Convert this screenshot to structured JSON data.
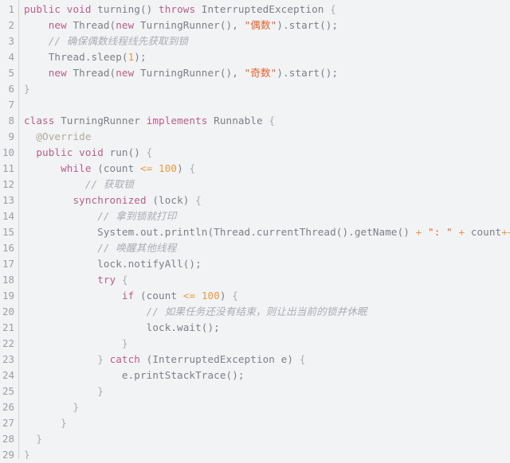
{
  "editor": {
    "language": "java",
    "background_color": "#f2f3f5",
    "gutter_color": "#f2f3f5",
    "line_number_color": "#9a9ea6",
    "total_lines": 29,
    "theme_colors": {
      "keyword": "#b75f8c",
      "string": "#e8622a",
      "number": "#e89a3c",
      "operator": "#e89a3c",
      "comment": "#a8acb4",
      "annotation": "#b0aa9a",
      "plain": "#7b7f88",
      "punctuation": "#a9adb5"
    }
  },
  "line_numbers": [
    "1",
    "2",
    "3",
    "4",
    "5",
    "6",
    "7",
    "8",
    "9",
    "10",
    "11",
    "12",
    "13",
    "14",
    "15",
    "16",
    "17",
    "18",
    "19",
    "20",
    "21",
    "22",
    "23",
    "24",
    "25",
    "26",
    "27",
    "28",
    "29"
  ],
  "code_lines": [
    {
      "n": 1,
      "tokens": [
        {
          "t": "public",
          "c": "kw"
        },
        {
          "t": " ",
          "c": "plain"
        },
        {
          "t": "void",
          "c": "kw"
        },
        {
          "t": " turning() ",
          "c": "plain"
        },
        {
          "t": "throws",
          "c": "kw"
        },
        {
          "t": " InterruptedException ",
          "c": "plain"
        },
        {
          "t": "{",
          "c": "punct"
        }
      ]
    },
    {
      "n": 2,
      "tokens": [
        {
          "t": "    ",
          "c": "plain"
        },
        {
          "t": "new",
          "c": "kw"
        },
        {
          "t": " Thread(",
          "c": "plain"
        },
        {
          "t": "new",
          "c": "kw"
        },
        {
          "t": " TurningRunner(), ",
          "c": "plain"
        },
        {
          "t": "\"偶数\"",
          "c": "str"
        },
        {
          "t": ").start();",
          "c": "plain"
        }
      ]
    },
    {
      "n": 3,
      "tokens": [
        {
          "t": "    ",
          "c": "plain"
        },
        {
          "t": "// 确保偶数线程线先获取到锁",
          "c": "comment"
        }
      ]
    },
    {
      "n": 4,
      "tokens": [
        {
          "t": "    Thread.sleep(",
          "c": "plain"
        },
        {
          "t": "1",
          "c": "num"
        },
        {
          "t": ");",
          "c": "plain"
        }
      ]
    },
    {
      "n": 5,
      "tokens": [
        {
          "t": "    ",
          "c": "plain"
        },
        {
          "t": "new",
          "c": "kw"
        },
        {
          "t": " Thread(",
          "c": "plain"
        },
        {
          "t": "new",
          "c": "kw"
        },
        {
          "t": " TurningRunner(), ",
          "c": "plain"
        },
        {
          "t": "\"奇数\"",
          "c": "str"
        },
        {
          "t": ").start();",
          "c": "plain"
        }
      ]
    },
    {
      "n": 6,
      "tokens": [
        {
          "t": "}",
          "c": "punct"
        }
      ]
    },
    {
      "n": 7,
      "tokens": []
    },
    {
      "n": 8,
      "tokens": [
        {
          "t": "class",
          "c": "kw"
        },
        {
          "t": " TurningRunner ",
          "c": "plain"
        },
        {
          "t": "implements",
          "c": "kw"
        },
        {
          "t": " Runnable ",
          "c": "plain"
        },
        {
          "t": "{",
          "c": "punct"
        }
      ]
    },
    {
      "n": 9,
      "tokens": [
        {
          "t": "  ",
          "c": "plain"
        },
        {
          "t": "@Override",
          "c": "anno"
        }
      ]
    },
    {
      "n": 10,
      "tokens": [
        {
          "t": "  ",
          "c": "plain"
        },
        {
          "t": "public",
          "c": "kw"
        },
        {
          "t": " ",
          "c": "plain"
        },
        {
          "t": "void",
          "c": "kw"
        },
        {
          "t": " run() ",
          "c": "plain"
        },
        {
          "t": "{",
          "c": "punct"
        }
      ]
    },
    {
      "n": 11,
      "tokens": [
        {
          "t": "      ",
          "c": "plain"
        },
        {
          "t": "while",
          "c": "kw"
        },
        {
          "t": " (count ",
          "c": "plain"
        },
        {
          "t": "<=",
          "c": "op"
        },
        {
          "t": " ",
          "c": "plain"
        },
        {
          "t": "100",
          "c": "num"
        },
        {
          "t": ") ",
          "c": "plain"
        },
        {
          "t": "{",
          "c": "punct"
        }
      ]
    },
    {
      "n": 12,
      "tokens": [
        {
          "t": "          ",
          "c": "plain"
        },
        {
          "t": "// 获取锁",
          "c": "comment"
        }
      ]
    },
    {
      "n": 13,
      "tokens": [
        {
          "t": "        ",
          "c": "plain"
        },
        {
          "t": "synchronized",
          "c": "kw"
        },
        {
          "t": " (lock) ",
          "c": "plain"
        },
        {
          "t": "{",
          "c": "punct"
        }
      ]
    },
    {
      "n": 14,
      "tokens": [
        {
          "t": "            ",
          "c": "plain"
        },
        {
          "t": "// 拿到锁就打印",
          "c": "comment"
        }
      ]
    },
    {
      "n": 15,
      "tokens": [
        {
          "t": "            System.out.println(Thread.currentThread().getName() ",
          "c": "plain"
        },
        {
          "t": "+",
          "c": "op"
        },
        {
          "t": " ",
          "c": "plain"
        },
        {
          "t": "\": \"",
          "c": "str"
        },
        {
          "t": " ",
          "c": "plain"
        },
        {
          "t": "+",
          "c": "op"
        },
        {
          "t": " count",
          "c": "plain"
        },
        {
          "t": "++",
          "c": "op"
        },
        {
          "t": ");",
          "c": "plain"
        }
      ]
    },
    {
      "n": 16,
      "tokens": [
        {
          "t": "            ",
          "c": "plain"
        },
        {
          "t": "// 唤醒其他线程",
          "c": "comment"
        }
      ]
    },
    {
      "n": 17,
      "tokens": [
        {
          "t": "            lock.notifyAll();",
          "c": "plain"
        }
      ]
    },
    {
      "n": 18,
      "tokens": [
        {
          "t": "            ",
          "c": "plain"
        },
        {
          "t": "try",
          "c": "kw"
        },
        {
          "t": " ",
          "c": "plain"
        },
        {
          "t": "{",
          "c": "punct"
        }
      ]
    },
    {
      "n": 19,
      "tokens": [
        {
          "t": "                ",
          "c": "plain"
        },
        {
          "t": "if",
          "c": "kw"
        },
        {
          "t": " (count ",
          "c": "plain"
        },
        {
          "t": "<=",
          "c": "op"
        },
        {
          "t": " ",
          "c": "plain"
        },
        {
          "t": "100",
          "c": "num"
        },
        {
          "t": ") ",
          "c": "plain"
        },
        {
          "t": "{",
          "c": "punct"
        }
      ]
    },
    {
      "n": 20,
      "tokens": [
        {
          "t": "                    ",
          "c": "plain"
        },
        {
          "t": "// 如果任务还没有结束，则让出当前的锁并休眠",
          "c": "comment"
        }
      ]
    },
    {
      "n": 21,
      "tokens": [
        {
          "t": "                    lock.wait();",
          "c": "plain"
        }
      ]
    },
    {
      "n": 22,
      "tokens": [
        {
          "t": "                ",
          "c": "plain"
        },
        {
          "t": "}",
          "c": "punct"
        }
      ]
    },
    {
      "n": 23,
      "tokens": [
        {
          "t": "            ",
          "c": "plain"
        },
        {
          "t": "}",
          "c": "punct"
        },
        {
          "t": " ",
          "c": "plain"
        },
        {
          "t": "catch",
          "c": "kw"
        },
        {
          "t": " (InterruptedException e) ",
          "c": "plain"
        },
        {
          "t": "{",
          "c": "punct"
        }
      ]
    },
    {
      "n": 24,
      "tokens": [
        {
          "t": "                e.printStackTrace();",
          "c": "plain"
        }
      ]
    },
    {
      "n": 25,
      "tokens": [
        {
          "t": "            ",
          "c": "plain"
        },
        {
          "t": "}",
          "c": "punct"
        }
      ]
    },
    {
      "n": 26,
      "tokens": [
        {
          "t": "        ",
          "c": "plain"
        },
        {
          "t": "}",
          "c": "punct"
        }
      ]
    },
    {
      "n": 27,
      "tokens": [
        {
          "t": "      ",
          "c": "plain"
        },
        {
          "t": "}",
          "c": "punct"
        }
      ]
    },
    {
      "n": 28,
      "tokens": [
        {
          "t": "  ",
          "c": "plain"
        },
        {
          "t": "}",
          "c": "punct"
        }
      ]
    },
    {
      "n": 29,
      "tokens": [
        {
          "t": "}",
          "c": "punct"
        }
      ]
    }
  ]
}
